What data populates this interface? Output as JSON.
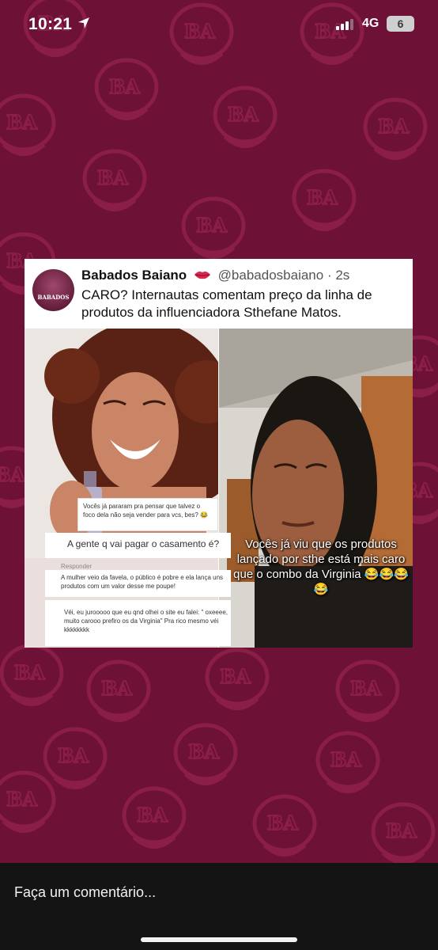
{
  "status_bar": {
    "time": "10:21",
    "network": "4G",
    "battery": "6"
  },
  "post": {
    "author_name": "Babados Baiano",
    "handle": "@babadosbaiano",
    "time_ago": "· 2s",
    "avatar_logo": "BABADOS",
    "tweet_text": "CARO? Internautas comentam preço da linha de produtos da influenciadora Sthefane Matos.",
    "comments": [
      "Vocês já pararam pra pensar que talvez o foco dela não seja vender para vcs, bes? 😂",
      "A gente q vai pagar o casamento é?",
      "A mulher veio da favela, o público é pobre e ela lança uns produtos com um valor desse me poupe!",
      "Véi, eu jurooooo que eu qnd olhei o site eu falei: \" oxeeee, muito carooo prefiro os da Virginia\" Pra rico mesmo véi kkkkkkkk"
    ],
    "reply_label": "Responder",
    "overlay_caption": "Vocês já viu que os produtos lançado por sthe está mais caro que o combo da Virginia 😂😂😂😂"
  },
  "comment_bar": {
    "placeholder": "Faça um comentário..."
  },
  "colors": {
    "background": "#6e1136",
    "pattern": "#8a1e47"
  }
}
